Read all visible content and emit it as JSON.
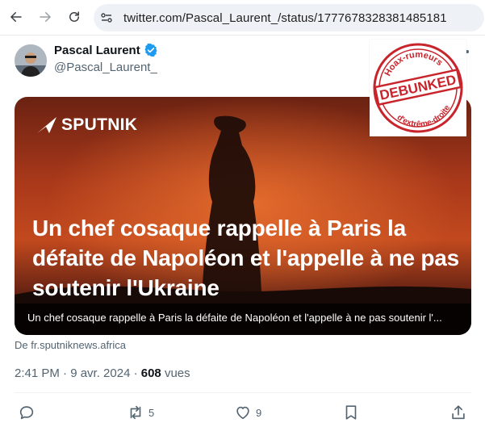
{
  "browser": {
    "url": "twitter.com/Pascal_Laurent_/status/1777678328381485181"
  },
  "tweet": {
    "display_name": "Pascal Laurent",
    "handle": "@Pascal_Laurent_",
    "headline": "Un chef cosaque rappelle à Paris la défaite de Napoléon et l'appelle à ne pas soutenir l'Ukraine",
    "brand": "SPUTNIK",
    "caption": "Un chef cosaque rappelle à Paris la défaite de Napoléon et l'appelle à ne pas soutenir l'...",
    "source": "De fr.sputniknews.africa",
    "time": "2:41 PM · 9 avr. 2024 · ",
    "views_count": "608",
    "views_label": " vues"
  },
  "stamp": {
    "top_text": "Hoax-rumeurs",
    "center_text": "DEBUNKED",
    "bottom_text": "d'extrême-droite"
  },
  "actions": {
    "retweet_count": "5",
    "like_count": "9"
  },
  "colors": {
    "verified": "#1d9bf0",
    "stamp_red": "#c8242b",
    "muted": "#536471"
  }
}
